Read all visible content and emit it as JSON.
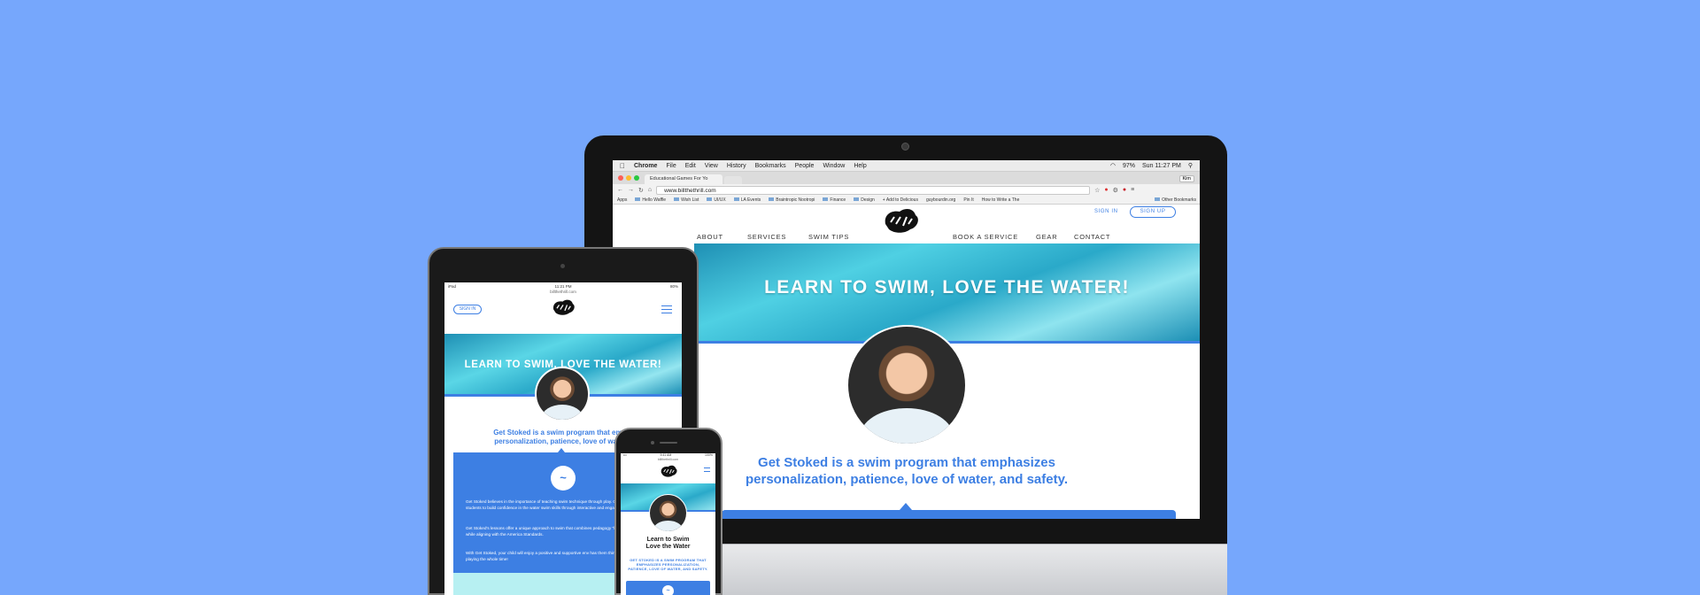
{
  "desktop": {
    "mac_menu": {
      "apple": "",
      "items": [
        "Chrome",
        "File",
        "Edit",
        "View",
        "History",
        "Bookmarks",
        "People",
        "Window",
        "Help"
      ],
      "battery": "97%",
      "clock": "Sun 11:27 PM"
    },
    "browser": {
      "tab_title": "Educational Games For Yo",
      "profile": "Kim",
      "url": "www.billthethrill.com",
      "bookmarks": [
        "Apps",
        "Hello Waffle",
        "Wish List",
        "UI/UX",
        "LA Events",
        "Braintropic Nootropi",
        "Finance",
        "Design",
        "+ Add to Delicious",
        "guybourdin.org",
        "Pin It",
        "How to Write a The"
      ],
      "other_bookmarks": "Other Bookmarks"
    },
    "site": {
      "sign_in": "SIGN IN",
      "sign_up": "SIGN UP",
      "nav_left": [
        "ABOUT",
        "SERVICES",
        "SWIM TIPS"
      ],
      "nav_right": [
        "BOOK A SERVICE",
        "GEAR",
        "CONTACT"
      ],
      "hero_title": "LEARN TO SWIM, LOVE THE WATER!",
      "tagline_1": "Get Stoked is a swim program that emphasizes",
      "tagline_2": "personalization, patience, love of water, and safety."
    }
  },
  "tablet": {
    "status_left": "iPad",
    "status_time": "11:21 PM",
    "status_right": "80%",
    "url": "billthethrill.com",
    "sign_in": "SIGN IN",
    "hero_title": "LEARN TO SWIM, LOVE THE WATER!",
    "tagline_1": "Get Stoked is a swim program that empha",
    "tagline_2": "personalization, patience, love of water, a",
    "para_1": "Get Stoked believes in the importance of teaching swim technique through play. Our lessons allow students to build confidence in the water swim skills through interactive and engaging games.",
    "para_2": "Get Stoked's lessons offer a unique approach to swim that combines pedagogy \"learning through doing\" while aligning with the America Standards.",
    "para_3": "With Get Stoked, your child will enjoy a positive and supportive env has them thinking they are just playing the whole time!"
  },
  "phone": {
    "status_time": "9:41 AM",
    "status_right": "100%",
    "url": "billthethrill.com",
    "title_1": "Learn to Swim",
    "title_2": "Love the Water",
    "subtitle": "GET STOKED IS A SWIM PROGRAM THAT EMPHASIZES PERSONALIZATION, PATIENCE, LOVE OF WATER, AND SAFETY."
  },
  "colors": {
    "background": "#76a7fc",
    "brand_blue": "#3d7fe3",
    "water": "#2aa9c9"
  }
}
